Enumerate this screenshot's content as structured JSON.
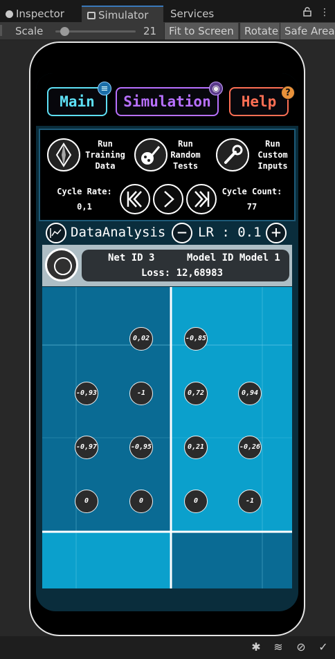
{
  "editor": {
    "tabs": [
      {
        "label": "Inspector",
        "icon": "info-icon"
      },
      {
        "label": "Simulator",
        "icon": "simulator-icon"
      },
      {
        "label": "Services",
        "icon": ""
      }
    ],
    "scale_label": "Scale",
    "scale_value": "21",
    "scale_fraction": 0.1,
    "fit_label": "Fit to Screen",
    "rotate_label": "Rotate",
    "safe_area_label": "Safe Area"
  },
  "app": {
    "nav": {
      "main_label": "Main",
      "simulation_label": "Simulation",
      "help_label": "Help"
    },
    "actions": {
      "training_label": [
        "Run",
        "Training",
        "Data"
      ],
      "random_label": [
        "Run",
        "Random",
        "Tests"
      ],
      "custom_label": [
        "Run",
        "Custom",
        "Inputs"
      ]
    },
    "cycle_rate_label": "Cycle Rate:",
    "cycle_rate_value": "0,1",
    "cycle_count_label": "Cycle Count:",
    "cycle_count_value": "77",
    "analysis_label": "DataAnalysis",
    "lr_label": "LR : 0.1",
    "minus_label": "−",
    "plus_label": "+",
    "net_id": "Net ID 3",
    "model_id": "Model ID Model 1",
    "loss": "Loss: 12,68983",
    "nodes": [
      [
        "",
        "0,02",
        "-0,85",
        ""
      ],
      [
        "-0,93",
        "-1",
        "0,72",
        "0,94"
      ],
      [
        "-0,97",
        "-0,95",
        "0,21",
        "-0,26"
      ],
      [
        "0",
        "0",
        "0",
        "-1"
      ]
    ]
  },
  "colors": {
    "main": "#5ee0f5",
    "simulation": "#b870ff",
    "help": "#ff6f54",
    "grid_dark": "#0a6b94",
    "grid_light": "#0ba0cc"
  }
}
